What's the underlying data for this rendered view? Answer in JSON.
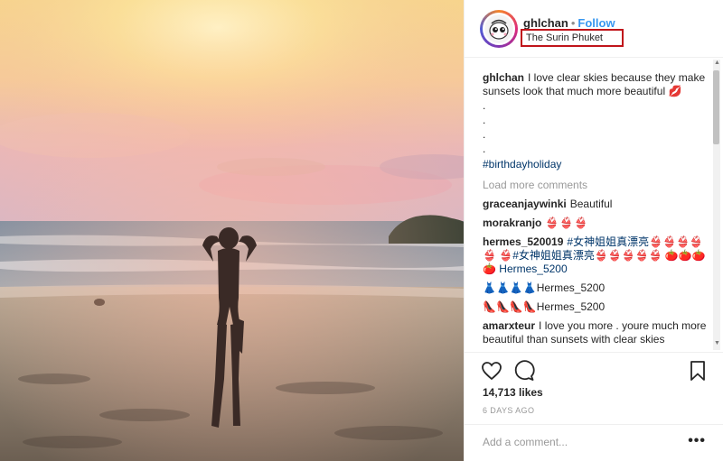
{
  "post": {
    "photo_alt": "",
    "header": {
      "username": "ghlchan",
      "separator": "•",
      "follow_label": "Follow",
      "location": "The Surin Phuket"
    },
    "caption": {
      "username": "ghlchan",
      "text": "I love clear skies because they make sunsets look that much more beautiful 💋",
      "dots": [
        ".",
        ".",
        ".",
        "."
      ],
      "hashtag": "#birthdayholiday"
    },
    "load_more_label": "Load more comments",
    "comments": [
      {
        "username": "graceanjaywinki",
        "text": "Beautiful"
      },
      {
        "username": "morakranjo",
        "text": "👙👙👙"
      },
      {
        "username": "hermes_520019",
        "text": "#女神姐姐真漂亮👙👙👙👙👙 👙#女神姐姐真漂亮👙👙👙👙👙 🍅🍅🍅🍅 Hermes_5200"
      },
      {
        "username": "",
        "text": "👗👗👗👗Hermes_5200"
      },
      {
        "username": "",
        "text": "👠👠👠👠Hermes_5200"
      },
      {
        "username": "amarxteur",
        "text": "I love you more . youre much more beautiful than sunsets with clear skies"
      }
    ],
    "likes": "14,713 likes",
    "time_ago": "6 DAYS AGO",
    "add_comment_placeholder": "Add a comment...",
    "more_options": "•••"
  },
  "icons": {
    "heart": "heart-icon",
    "comment": "comment-icon",
    "bookmark": "bookmark-icon",
    "more": "more-options-icon"
  },
  "colors": {
    "follow": "#3897f0",
    "location_box": "#c0141a",
    "hashtag": "#003569"
  }
}
